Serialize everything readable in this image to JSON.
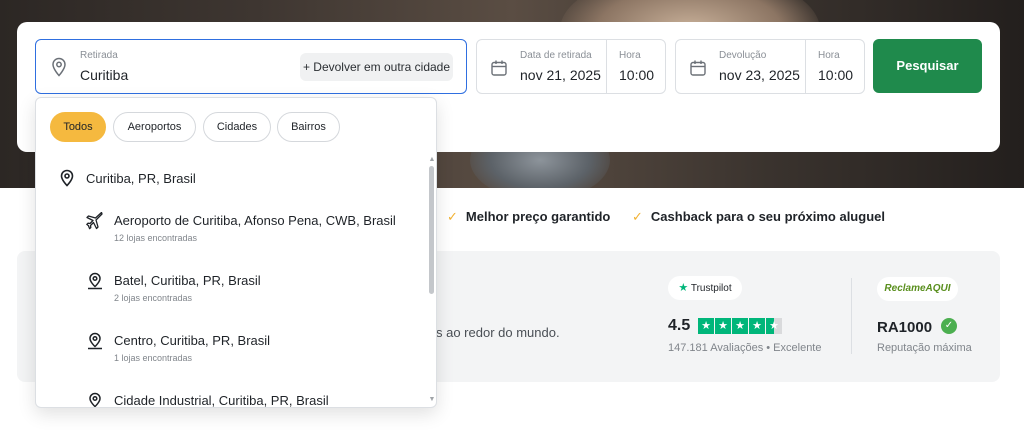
{
  "search": {
    "pickup_label": "Retirada",
    "pickup_value": "Curitiba",
    "return_other_label": "+ Devolver em outra cidade",
    "pickup_date_label": "Data de retirada",
    "pickup_date_value": "nov 21, 2025",
    "pickup_time_label": "Hora",
    "pickup_time_value": "10:00",
    "return_date_label": "Devolução",
    "return_date_value": "nov 23, 2025",
    "return_time_label": "Hora",
    "return_time_value": "10:00",
    "search_button": "Pesquisar"
  },
  "dropdown": {
    "filters": [
      "Todos",
      "Aeroportos",
      "Cidades",
      "Bairros"
    ],
    "active_filter": "Todos",
    "results": [
      {
        "icon": "location-pin-icon",
        "title": "Curitiba, PR, Brasil",
        "subtitle": ""
      },
      {
        "icon": "airplane-icon",
        "title": "Aeroporto de Curitiba, Afonso Pena, CWB, Brasil",
        "subtitle": "12 lojas encontradas"
      },
      {
        "icon": "map-pin-icon",
        "title": "Batel, Curitiba, PR, Brasil",
        "subtitle": "2 lojas encontradas"
      },
      {
        "icon": "map-pin-icon",
        "title": "Centro, Curitiba, PR, Brasil",
        "subtitle": "1 lojas encontradas"
      },
      {
        "icon": "map-pin-icon",
        "title": "Cidade Industrial, Curitiba, PR, Brasil",
        "subtitle": ""
      }
    ]
  },
  "benefits": [
    {
      "icon": "check-icon",
      "label": "Melhor preço garantido"
    },
    {
      "icon": "check-icon",
      "label": "Cashback para o seu próximo aluguel"
    }
  ],
  "info": {
    "text_fragment": "s ao redor do mundo."
  },
  "trustpilot": {
    "badge": "Trustpilot",
    "score": "4.5",
    "stars": 4.5,
    "reviews": "147.181  Avaliações • Excelente"
  },
  "reclameaqui": {
    "badge": "ReclameAQUI",
    "score": "RA1000",
    "caption": "Reputação máxima"
  },
  "colors": {
    "accent_green": "#1f8a4c",
    "chip_active": "#f5b93f",
    "check": "#f2b233",
    "trustpilot_green": "#00b67a",
    "focus_blue": "#2f6fe0"
  }
}
